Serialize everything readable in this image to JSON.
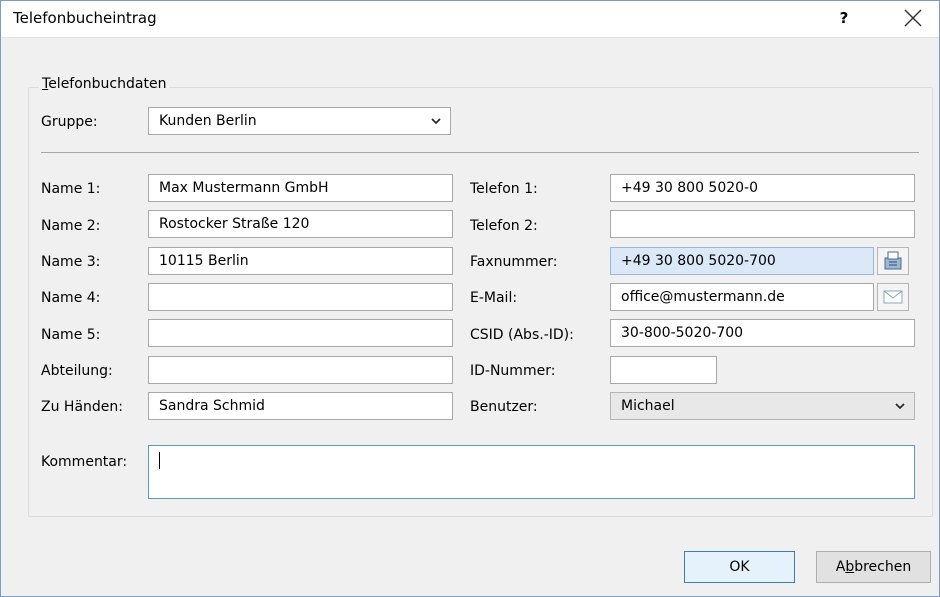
{
  "window": {
    "title": "Telefonbucheintrag",
    "help": "?"
  },
  "group": {
    "legend_first": "T",
    "legend_rest": "elefonbuchdaten"
  },
  "gruppe": {
    "label": "Gruppe:",
    "value": "Kunden Berlin"
  },
  "left_fields": [
    {
      "label": "Name 1:",
      "value": "Max Mustermann GmbH"
    },
    {
      "label": "Name 2:",
      "value": "Rostocker Straße 120"
    },
    {
      "label": "Name 3:",
      "value": "10115 Berlin"
    },
    {
      "label": "Name 4:",
      "value": ""
    },
    {
      "label": "Name 5:",
      "value": ""
    },
    {
      "label": "Abteilung:",
      "value": ""
    },
    {
      "label": "Zu Händen:",
      "value": "Sandra Schmid"
    }
  ],
  "right_fields": {
    "telefon1": {
      "label": "Telefon 1:",
      "value": "+49 30 800 5020-0"
    },
    "telefon2": {
      "label": "Telefon 2:",
      "value": ""
    },
    "fax": {
      "label": "Faxnummer:",
      "value": "+49 30 800 5020-700"
    },
    "email": {
      "label": "E-Mail:",
      "value": "office@mustermann.de"
    },
    "csid": {
      "label": "CSID (Abs.-ID):",
      "value": "30-800-5020-700"
    },
    "idnummer": {
      "label": "ID-Nummer:",
      "value": ""
    },
    "benutzer": {
      "label": "Benutzer:",
      "value": "Michael"
    }
  },
  "kommentar": {
    "label": "Kommentar:",
    "value": ""
  },
  "buttons": {
    "ok": "OK",
    "cancel_pre": "A",
    "cancel_mn": "b",
    "cancel_post": "brechen"
  },
  "icons": {
    "chevron": "chevron-down-icon",
    "fax": "fax-icon",
    "mail": "mail-icon",
    "close": "close-icon"
  },
  "colors": {
    "accent": "#3c7fb1",
    "focus_field": "#dbe8f7"
  }
}
